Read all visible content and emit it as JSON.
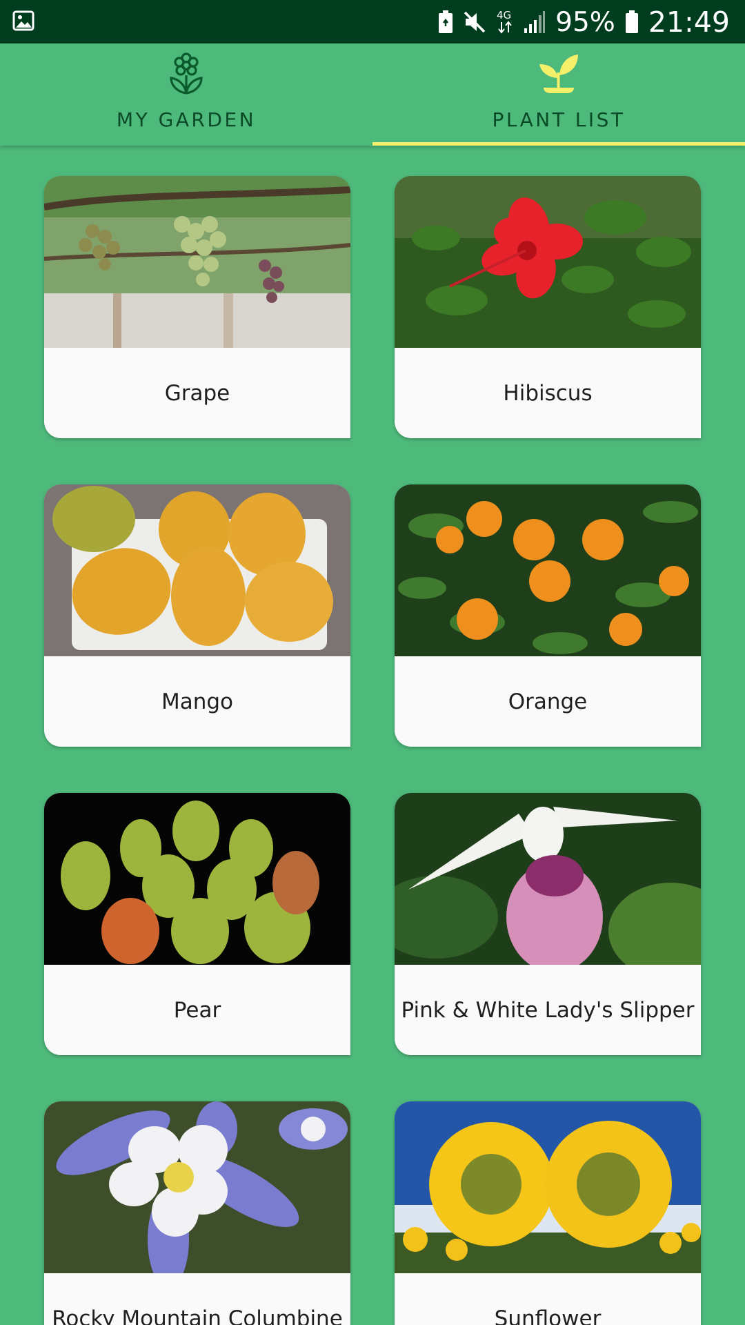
{
  "status_bar": {
    "battery_percent": "95%",
    "time": "21:49",
    "icons": [
      "gallery-icon",
      "battery-saver-icon",
      "mute-icon",
      "4g-icon",
      "signal-icon",
      "battery-icon"
    ]
  },
  "tabs": [
    {
      "label": "MY GARDEN",
      "icon": "flower-icon",
      "active": false
    },
    {
      "label": "PLANT LIST",
      "icon": "sprout-icon",
      "active": true
    }
  ],
  "colors": {
    "background": "#4DB97A",
    "status_bar": "#003D1F",
    "tab_indicator": "#F4F06A",
    "tab_text": "#0B4A26",
    "card": "#FAFAFA"
  },
  "plants": [
    {
      "name": "Grape"
    },
    {
      "name": "Hibiscus"
    },
    {
      "name": "Mango"
    },
    {
      "name": "Orange"
    },
    {
      "name": "Pear"
    },
    {
      "name": "Pink & White Lady's Slipper"
    },
    {
      "name": "Rocky Mountain Columbine"
    },
    {
      "name": "Sunflower"
    }
  ]
}
